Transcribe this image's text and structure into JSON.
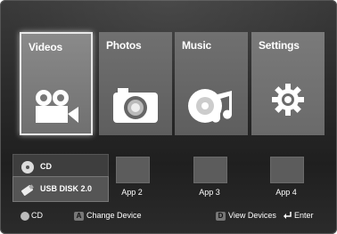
{
  "tiles": [
    {
      "label": "Videos",
      "icon": "video-camera-icon"
    },
    {
      "label": "Photos",
      "icon": "camera-icon"
    },
    {
      "label": "Music",
      "icon": "music-disc-icon"
    },
    {
      "label": "Settings",
      "icon": "gear-icon"
    }
  ],
  "devices": [
    {
      "label": "CD",
      "icon": "cd-icon"
    },
    {
      "label": "USB DISK 2.0",
      "icon": "usb-icon"
    }
  ],
  "apps": [
    {
      "label": "App 2"
    },
    {
      "label": "App 3"
    },
    {
      "label": "App 4"
    }
  ],
  "bottom_bar": {
    "cd_label": "CD",
    "a_key": "A",
    "change_device": "Change Device",
    "d_key": "D",
    "view_devices": "View Devices",
    "enter": "Enter"
  }
}
